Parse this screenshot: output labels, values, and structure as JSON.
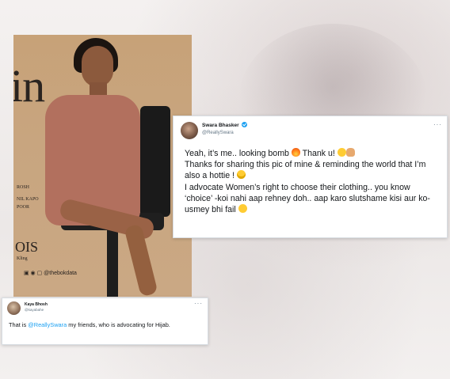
{
  "main_tweet": {
    "author_name": "Swara Bhasker",
    "author_handle": "@ReallySwara",
    "more_label": "···",
    "lines": [
      "Yeah, it’s me.. looking bomb",
      "Thank u!",
      "Thanks for sharing this pic of mine & reminding the world that I’m also a hottie !",
      "I advocate Women’s right to choose their clothing.. you know ‘choice’ -koi nahi aap rehney doh.. aap karo slutshame kisi aur ko- usmey bhi fail"
    ],
    "emojis": [
      "fire-emoji",
      "hugging-emoji",
      "praying-hands-emoji",
      "nerd-emoji",
      "grinning-emoji"
    ]
  },
  "reply_tweet": {
    "author_name": "Kaya Bhosh",
    "author_handle": "@kayabahe",
    "more_label": "···",
    "text_before": "That is ",
    "mention": "@ReallySwara",
    "text_after": " my friends, who is advocating for Hijab."
  },
  "photo": {
    "big_text": "in",
    "small_texts": [
      "ROSH",
      "NIL KAPO",
      "POOR",
      "OIS",
      "Kling"
    ],
    "social_text": "@thebokdata"
  }
}
